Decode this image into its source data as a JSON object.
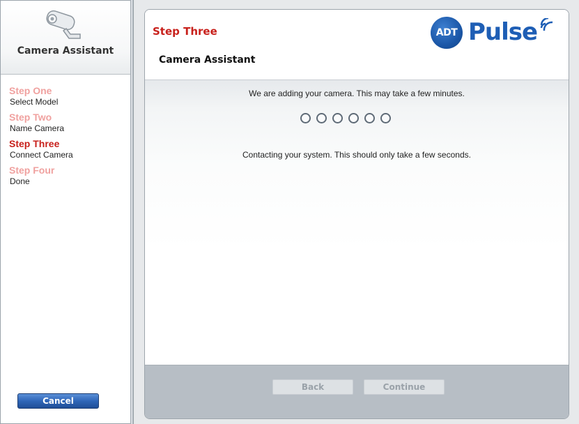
{
  "sidebar": {
    "title": "Camera Assistant",
    "icon": "security-camera-icon",
    "steps": [
      {
        "title": "Step One",
        "subtitle": "Select Model",
        "state": "inactive"
      },
      {
        "title": "Step Two",
        "subtitle": "Name Camera",
        "state": "inactive"
      },
      {
        "title": "Step Three",
        "subtitle": "Connect Camera",
        "state": "active"
      },
      {
        "title": "Step Four",
        "subtitle": "Done",
        "state": "inactive"
      }
    ],
    "cancel_label": "Cancel"
  },
  "panel": {
    "step_heading": "Step Three",
    "title": "Camera Assistant",
    "logo": {
      "badge": "ADT",
      "text": "Pulse"
    },
    "status_main": "We are adding your camera. This may take a few minutes.",
    "progress_dot_count": 6,
    "status_detail": "Contacting your system. This should only take a few seconds.",
    "back_label": "Back",
    "continue_label": "Continue"
  },
  "colors": {
    "active_step": "#c8211c",
    "inactive_step": "#f0a19f",
    "brand_blue": "#1e5eb5",
    "footer": "#b7bec5"
  }
}
